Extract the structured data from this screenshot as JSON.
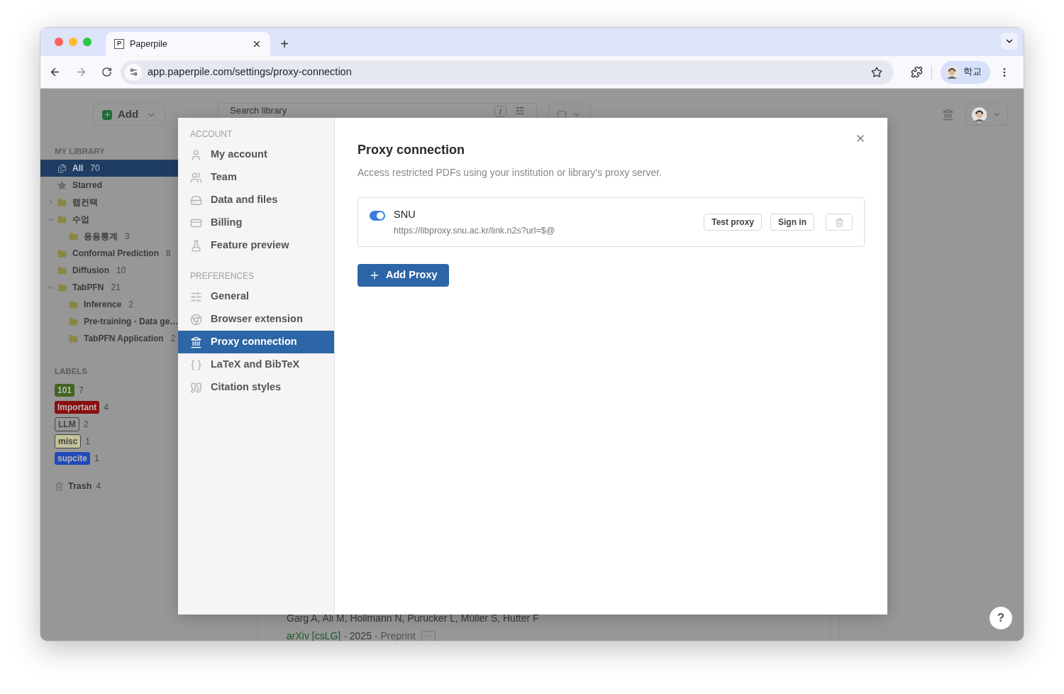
{
  "browser": {
    "tab_title": "Paperpile",
    "tab_favicon": "P",
    "new_tab": "+",
    "address": "app.paperpile.com/settings/proxy-connection",
    "profile_label": "학교"
  },
  "topbar": {
    "add_label": "Add",
    "search_placeholder": "Search library",
    "search_key": "/",
    "select_all_checked": false
  },
  "sidebar": {
    "heading": "MY LIBRARY",
    "items": [
      {
        "kind": "all",
        "label": "All",
        "count": "70",
        "selected": true
      },
      {
        "kind": "starred",
        "label": "Starred",
        "selected": false
      },
      {
        "kind": "folder",
        "label": "랩컨택",
        "selected": false,
        "expanded": false
      },
      {
        "kind": "folder",
        "label": "수업",
        "selected": false,
        "expanded": true,
        "children": [
          {
            "kind": "folder",
            "label": "응용통계",
            "count": "3",
            "selected": false
          }
        ]
      },
      {
        "kind": "folder",
        "label": "Conformal Prediction",
        "count": "8",
        "selected": false
      },
      {
        "kind": "folder",
        "label": "Diffusion",
        "count": "10",
        "selected": false
      },
      {
        "kind": "folder",
        "label": "TabPFN",
        "count": "21",
        "selected": false,
        "expanded": true,
        "children": [
          {
            "kind": "folder",
            "label": "Inference",
            "count": "2",
            "selected": false
          },
          {
            "kind": "folder",
            "label": "Pre-training - Data ge…",
            "selected": false
          },
          {
            "kind": "folder",
            "label": "TabPFN Application",
            "count": "2",
            "selected": false
          }
        ]
      }
    ],
    "labels_heading": "LABELS",
    "labels": [
      {
        "name": "101",
        "count": "7",
        "kind": "filled",
        "color": "#41651f"
      },
      {
        "name": "Important",
        "count": "4",
        "kind": "filled",
        "color": "#8b0e0e"
      },
      {
        "name": "LLM",
        "count": "2",
        "kind": "outline",
        "color": "#979797"
      },
      {
        "name": "misc",
        "count": "1",
        "kind": "outline",
        "color": "#c3c29a"
      },
      {
        "name": "supcite",
        "count": "1",
        "kind": "filled",
        "color": "#2249b8"
      }
    ],
    "trash": {
      "label": "Trash",
      "count": "4"
    }
  },
  "paper": {
    "authors": "Garg A, Ali M, Hollmann N, Purucker L, Müller S, Hutter F",
    "venue": "arXiv [csLG]",
    "year": "· 2025 ·",
    "type": "Preprint",
    "more": "···"
  },
  "help": "?",
  "settings": {
    "nav": [
      {
        "title": "ACCOUNT",
        "items": [
          {
            "label": "My account",
            "selected": false
          },
          {
            "label": "Team",
            "selected": false
          },
          {
            "label": "Data and files",
            "selected": false
          },
          {
            "label": "Billing",
            "selected": false
          },
          {
            "label": "Feature preview",
            "selected": false
          }
        ]
      },
      {
        "title": "PREFERENCES",
        "items": [
          {
            "label": "General",
            "selected": false
          },
          {
            "label": "Browser extension",
            "selected": false
          },
          {
            "label": "Proxy connection",
            "selected": true
          },
          {
            "label": "LaTeX and BibTeX",
            "selected": false
          },
          {
            "label": "Citation styles",
            "selected": false
          }
        ]
      }
    ],
    "title": "Proxy connection",
    "description": "Access restricted PDFs using your institution or library's proxy server.",
    "proxies": [
      {
        "name": "SNU",
        "url": "https://libproxy.snu.ac.kr/link.n2s?url=$@",
        "on": true,
        "test_label": "Test proxy",
        "sign_in_label": "Sign in"
      }
    ],
    "add_label": "Add Proxy"
  }
}
